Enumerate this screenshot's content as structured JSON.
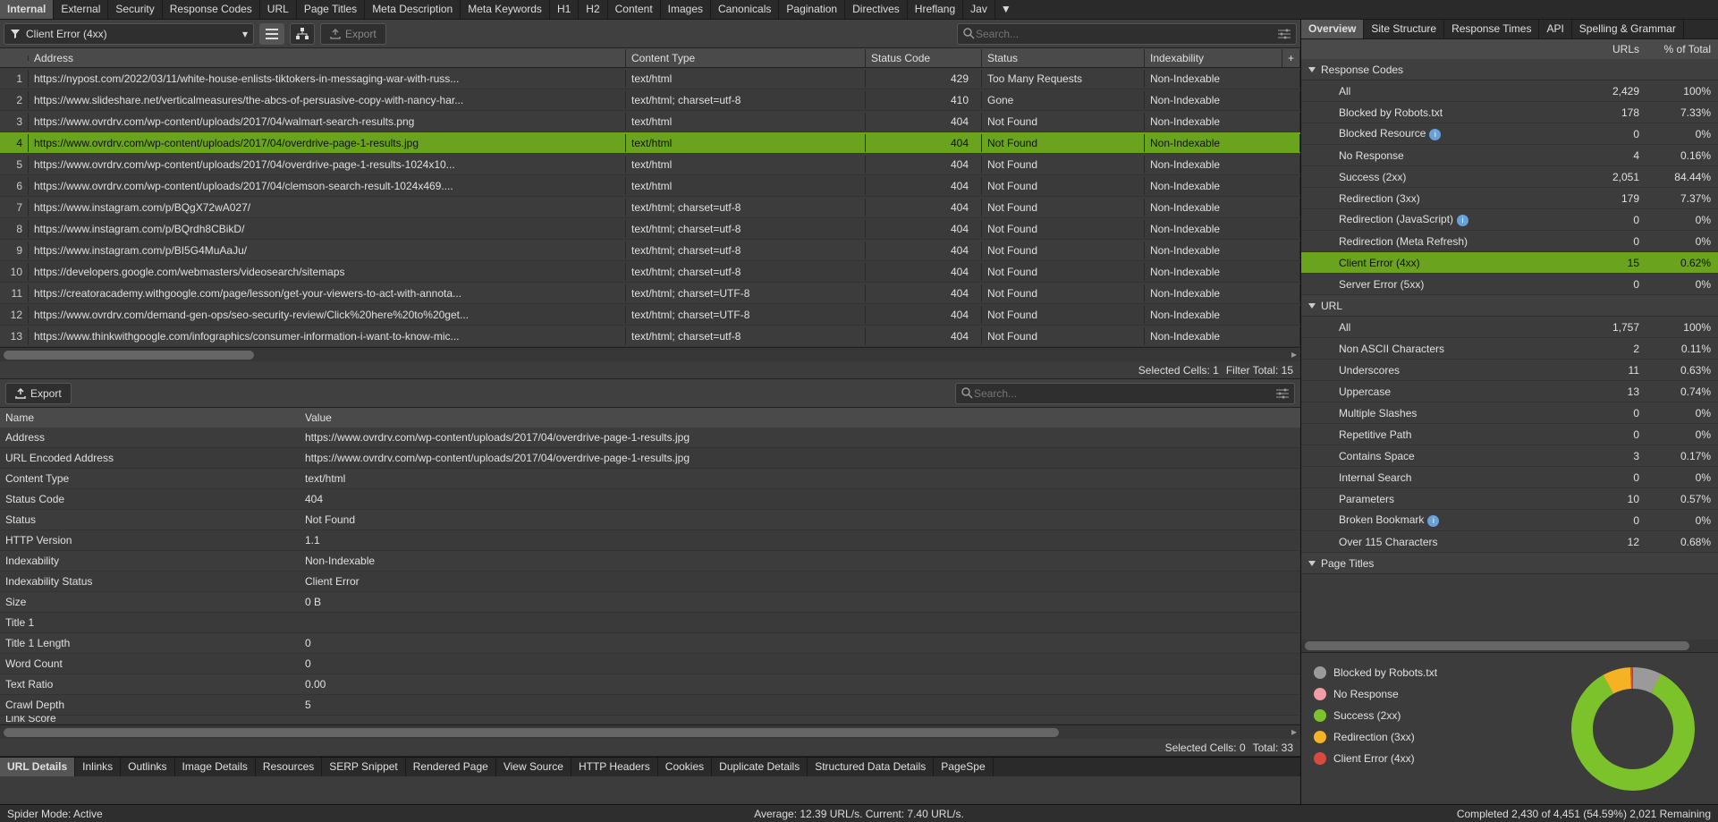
{
  "colors": {
    "accent": "#6aa31e",
    "rowSel": "#6aa31e",
    "donut": {
      "blocked": "#9a9a9a",
      "noresp": "#f19ca6",
      "success": "#7cc22a",
      "redir": "#f5b324",
      "clienterr": "#d84b3e"
    }
  },
  "topTabs": [
    "Internal",
    "External",
    "Security",
    "Response Codes",
    "URL",
    "Page Titles",
    "Meta Description",
    "Meta Keywords",
    "H1",
    "H2",
    "Content",
    "Images",
    "Canonicals",
    "Pagination",
    "Directives",
    "Hreflang",
    "Jav"
  ],
  "topTabDropdown": "▼",
  "filter": {
    "label": "Client Error (4xx)"
  },
  "exportLabel": "Export",
  "searchPlaceholder": "Search...",
  "tableHeaders": {
    "address": "Address",
    "ct": "Content Type",
    "sc": "Status Code",
    "st": "Status",
    "ix": "Indexability",
    "plus": "+"
  },
  "rows": [
    {
      "n": 1,
      "addr": "https://nypost.com/2022/03/11/white-house-enlists-tiktokers-in-messaging-war-with-russ...",
      "ct": "text/html",
      "sc": 429,
      "st": "Too Many Requests",
      "ix": "Non-Indexable"
    },
    {
      "n": 2,
      "addr": "https://www.slideshare.net/verticalmeasures/the-abcs-of-persuasive-copy-with-nancy-har...",
      "ct": "text/html; charset=utf-8",
      "sc": 410,
      "st": "Gone",
      "ix": "Non-Indexable"
    },
    {
      "n": 3,
      "addr": "https://www.ovrdrv.com/wp-content/uploads/2017/04/walmart-search-results.png",
      "ct": "text/html",
      "sc": 404,
      "st": "Not Found",
      "ix": "Non-Indexable"
    },
    {
      "n": 4,
      "addr": "https://www.ovrdrv.com/wp-content/uploads/2017/04/overdrive-page-1-results.jpg",
      "ct": "text/html",
      "sc": 404,
      "st": "Not Found",
      "ix": "Non-Indexable",
      "sel": true
    },
    {
      "n": 5,
      "addr": "https://www.ovrdrv.com/wp-content/uploads/2017/04/overdrive-page-1-results-1024x10...",
      "ct": "text/html",
      "sc": 404,
      "st": "Not Found",
      "ix": "Non-Indexable"
    },
    {
      "n": 6,
      "addr": "https://www.ovrdrv.com/wp-content/uploads/2017/04/clemson-search-result-1024x469....",
      "ct": "text/html",
      "sc": 404,
      "st": "Not Found",
      "ix": "Non-Indexable"
    },
    {
      "n": 7,
      "addr": "https://www.instagram.com/p/BQgX72wA027/",
      "ct": "text/html; charset=utf-8",
      "sc": 404,
      "st": "Not Found",
      "ix": "Non-Indexable"
    },
    {
      "n": 8,
      "addr": "https://www.instagram.com/p/BQrdh8CBikD/",
      "ct": "text/html; charset=utf-8",
      "sc": 404,
      "st": "Not Found",
      "ix": "Non-Indexable"
    },
    {
      "n": 9,
      "addr": "https://www.instagram.com/p/BI5G4MuAaJu/",
      "ct": "text/html; charset=utf-8",
      "sc": 404,
      "st": "Not Found",
      "ix": "Non-Indexable"
    },
    {
      "n": 10,
      "addr": "https://developers.google.com/webmasters/videosearch/sitemaps",
      "ct": "text/html; charset=utf-8",
      "sc": 404,
      "st": "Not Found",
      "ix": "Non-Indexable"
    },
    {
      "n": 11,
      "addr": "https://creatoracademy.withgoogle.com/page/lesson/get-your-viewers-to-act-with-annota...",
      "ct": "text/html; charset=UTF-8",
      "sc": 404,
      "st": "Not Found",
      "ix": "Non-Indexable"
    },
    {
      "n": 12,
      "addr": "https://www.ovrdrv.com/demand-gen-ops/seo-security-review/Click%20here%20to%20get...",
      "ct": "text/html; charset=UTF-8",
      "sc": 404,
      "st": "Not Found",
      "ix": "Non-Indexable"
    },
    {
      "n": 13,
      "addr": "https://www.thinkwithgoogle.com/infographics/consumer-information-i-want-to-know-mic...",
      "ct": "text/html; charset=utf-8",
      "sc": 404,
      "st": "Not Found",
      "ix": "Non-Indexable"
    }
  ],
  "tableStatus": {
    "selected": "Selected Cells: 1",
    "filterTotal": "Filter Total: 15"
  },
  "details": {
    "export": "Export",
    "headers": {
      "name": "Name",
      "value": "Value"
    },
    "rows": [
      {
        "n": "Address",
        "v": "https://www.ovrdrv.com/wp-content/uploads/2017/04/overdrive-page-1-results.jpg"
      },
      {
        "n": "URL Encoded Address",
        "v": "https://www.ovrdrv.com/wp-content/uploads/2017/04/overdrive-page-1-results.jpg"
      },
      {
        "n": "Content Type",
        "v": "text/html"
      },
      {
        "n": "Status Code",
        "v": "404"
      },
      {
        "n": "Status",
        "v": "Not Found"
      },
      {
        "n": "HTTP Version",
        "v": "1.1"
      },
      {
        "n": "Indexability",
        "v": "Non-Indexable"
      },
      {
        "n": "Indexability Status",
        "v": "Client Error"
      },
      {
        "n": "Size",
        "v": "0 B"
      },
      {
        "n": "Title 1",
        "v": ""
      },
      {
        "n": "Title 1 Length",
        "v": "0"
      },
      {
        "n": "Word Count",
        "v": "0"
      },
      {
        "n": "Text Ratio",
        "v": "0.00"
      },
      {
        "n": "Crawl Depth",
        "v": "5"
      }
    ],
    "status": {
      "selected": "Selected Cells: 0",
      "total": "Total: 33"
    },
    "tabs": [
      "URL Details",
      "Inlinks",
      "Outlinks",
      "Image Details",
      "Resources",
      "SERP Snippet",
      "Rendered Page",
      "View Source",
      "HTTP Headers",
      "Cookies",
      "Duplicate Details",
      "Structured Data Details",
      "PageSpe"
    ]
  },
  "overviewTabs": [
    "Overview",
    "Site Structure",
    "Response Times",
    "API",
    "Spelling & Grammar"
  ],
  "overviewHeaders": {
    "urls": "URLs",
    "pct": "% of Total"
  },
  "overview": {
    "groups": [
      {
        "name": "Response Codes",
        "items": [
          {
            "n": "All",
            "c": "2,429",
            "p": "100%"
          },
          {
            "n": "Blocked by Robots.txt",
            "c": "178",
            "p": "7.33%"
          },
          {
            "n": "Blocked Resource",
            "info": true,
            "c": "0",
            "p": "0%"
          },
          {
            "n": "No Response",
            "c": "4",
            "p": "0.16%"
          },
          {
            "n": "Success (2xx)",
            "c": "2,051",
            "p": "84.44%"
          },
          {
            "n": "Redirection (3xx)",
            "c": "179",
            "p": "7.37%"
          },
          {
            "n": "Redirection (JavaScript)",
            "info": true,
            "c": "0",
            "p": "0%"
          },
          {
            "n": "Redirection (Meta Refresh)",
            "c": "0",
            "p": "0%"
          },
          {
            "n": "Client Error (4xx)",
            "c": "15",
            "p": "0.62%",
            "sel": true
          },
          {
            "n": "Server Error (5xx)",
            "c": "0",
            "p": "0%"
          }
        ]
      },
      {
        "name": "URL",
        "items": [
          {
            "n": "All",
            "c": "1,757",
            "p": "100%"
          },
          {
            "n": "Non ASCII Characters",
            "c": "2",
            "p": "0.11%"
          },
          {
            "n": "Underscores",
            "c": "11",
            "p": "0.63%"
          },
          {
            "n": "Uppercase",
            "c": "13",
            "p": "0.74%"
          },
          {
            "n": "Multiple Slashes",
            "c": "0",
            "p": "0%"
          },
          {
            "n": "Repetitive Path",
            "c": "0",
            "p": "0%"
          },
          {
            "n": "Contains Space",
            "c": "3",
            "p": "0.17%"
          },
          {
            "n": "Internal Search",
            "c": "0",
            "p": "0%"
          },
          {
            "n": "Parameters",
            "c": "10",
            "p": "0.57%"
          },
          {
            "n": "Broken Bookmark",
            "info": true,
            "c": "0",
            "p": "0%"
          },
          {
            "n": "Over 115 Characters",
            "c": "12",
            "p": "0.68%"
          }
        ]
      },
      {
        "name": "Page Titles",
        "collapsed": false,
        "items": []
      }
    ]
  },
  "legend": [
    {
      "label": "Blocked by Robots.txt",
      "color": "#9a9a9a"
    },
    {
      "label": "No Response",
      "color": "#f19ca6"
    },
    {
      "label": "Success (2xx)",
      "color": "#7cc22a"
    },
    {
      "label": "Redirection (3xx)",
      "color": "#f5b324"
    },
    {
      "label": "Client Error (4xx)",
      "color": "#d84b3e"
    }
  ],
  "chart_data": {
    "type": "pie",
    "title": "",
    "series": [
      {
        "name": "Response Codes",
        "values": [
          {
            "label": "Blocked by Robots.txt",
            "value": 178,
            "pct": 7.33,
            "color": "#9a9a9a"
          },
          {
            "label": "No Response",
            "value": 4,
            "pct": 0.16,
            "color": "#f19ca6"
          },
          {
            "label": "Success (2xx)",
            "value": 2051,
            "pct": 84.44,
            "color": "#7cc22a"
          },
          {
            "label": "Redirection (3xx)",
            "value": 179,
            "pct": 7.37,
            "color": "#f5b324"
          },
          {
            "label": "Client Error (4xx)",
            "value": 15,
            "pct": 0.62,
            "color": "#d84b3e"
          }
        ]
      }
    ]
  },
  "statusBar": {
    "left": "Spider Mode: Active",
    "center": "Average: 12.39 URL/s. Current: 7.40 URL/s.",
    "right": "Completed 2,430 of 4,451 (54.59%) 2,021 Remaining"
  }
}
